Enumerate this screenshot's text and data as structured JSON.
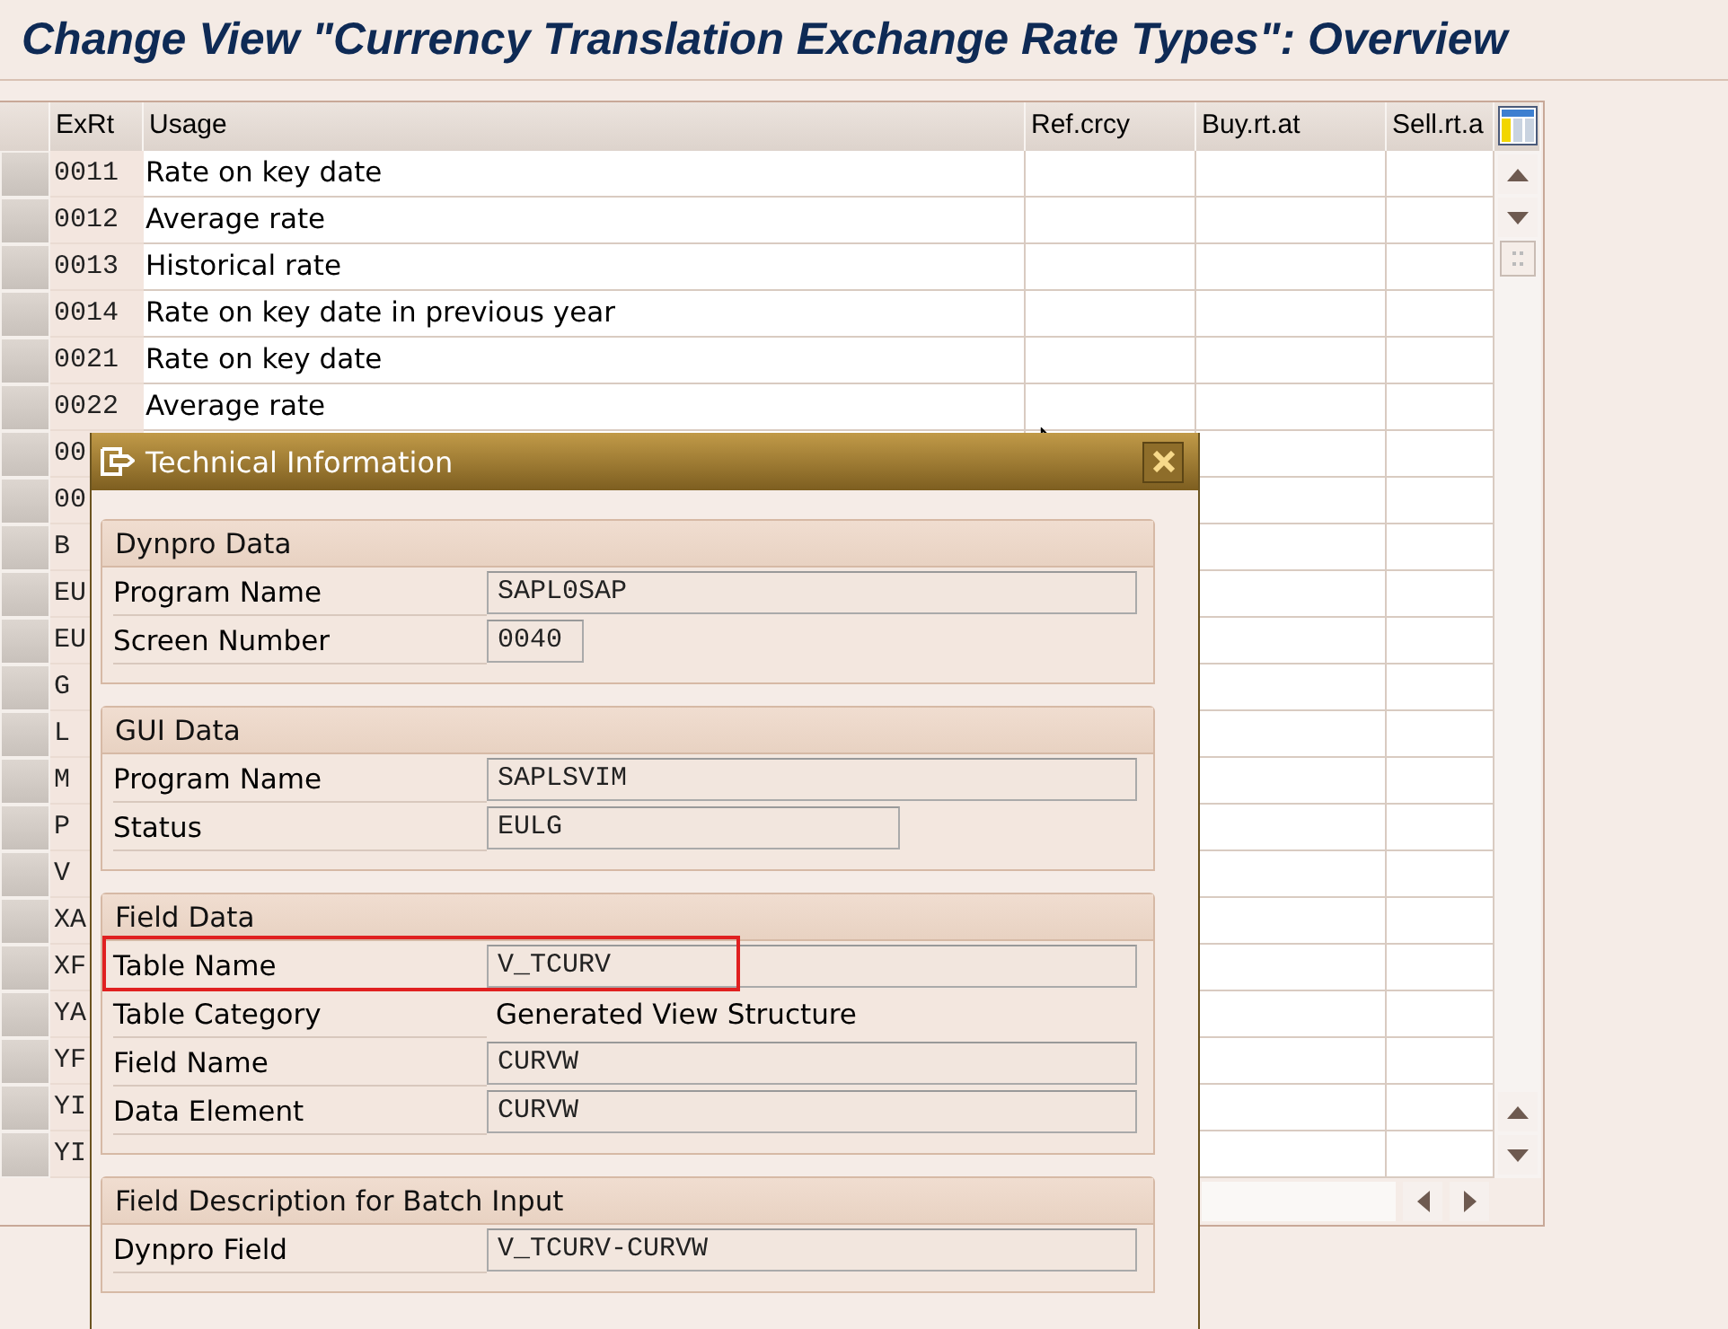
{
  "title": "Change View \"Currency Translation Exchange Rate Types\": Overview",
  "table": {
    "columns": [
      "ExRt",
      "Usage",
      "Ref.crcy",
      "Buy.rt.at",
      "Sell.rt.a"
    ],
    "rows": [
      {
        "exrt": "0011",
        "usage": "Rate on key date"
      },
      {
        "exrt": "0012",
        "usage": "Average rate"
      },
      {
        "exrt": "0013",
        "usage": "Historical rate"
      },
      {
        "exrt": "0014",
        "usage": "Rate on key date in previous year"
      },
      {
        "exrt": "0021",
        "usage": "Rate on key date"
      },
      {
        "exrt": "0022",
        "usage": "Average rate"
      },
      {
        "exrt": "00"
      },
      {
        "exrt": "00"
      },
      {
        "exrt": "B"
      },
      {
        "exrt": "EU"
      },
      {
        "exrt": "EU"
      },
      {
        "exrt": "G"
      },
      {
        "exrt": "L"
      },
      {
        "exrt": "M"
      },
      {
        "exrt": "P"
      },
      {
        "exrt": "V"
      },
      {
        "exrt": "XA"
      },
      {
        "exrt": "XF"
      },
      {
        "exrt": "YA"
      },
      {
        "exrt": "YF"
      },
      {
        "exrt": "YI"
      },
      {
        "exrt": "YI"
      }
    ]
  },
  "dialog": {
    "title": "Technical Information",
    "groups": [
      {
        "title": "Dynpro Data",
        "items": [
          {
            "label": "Program Name",
            "value": "SAPL0SAP",
            "kind": "field",
            "highlighted": false
          },
          {
            "label": "Screen Number",
            "value": "0040",
            "kind": "shortfield",
            "highlighted": false
          }
        ]
      },
      {
        "title": "GUI Data",
        "items": [
          {
            "label": "Program Name",
            "value": "SAPLSVIM",
            "kind": "field",
            "highlighted": false
          },
          {
            "label": "Status",
            "value": "EULG",
            "kind": "mediumfield",
            "highlighted": false
          }
        ]
      },
      {
        "title": "Field Data",
        "items": [
          {
            "label": "Table Name",
            "value": "V_TCURV",
            "kind": "field",
            "highlighted": true
          },
          {
            "label": "Table Category",
            "value": "Generated View Structure",
            "kind": "text",
            "highlighted": false
          },
          {
            "label": "Field Name",
            "value": "CURVW",
            "kind": "field",
            "highlighted": false
          },
          {
            "label": "Data Element",
            "value": "CURVW",
            "kind": "field",
            "highlighted": false
          }
        ]
      },
      {
        "title": "Field Description for Batch Input",
        "items": [
          {
            "label": "Dynpro Field",
            "value": "V_TCURV-CURVW",
            "kind": "field",
            "highlighted": false
          }
        ]
      }
    ]
  }
}
